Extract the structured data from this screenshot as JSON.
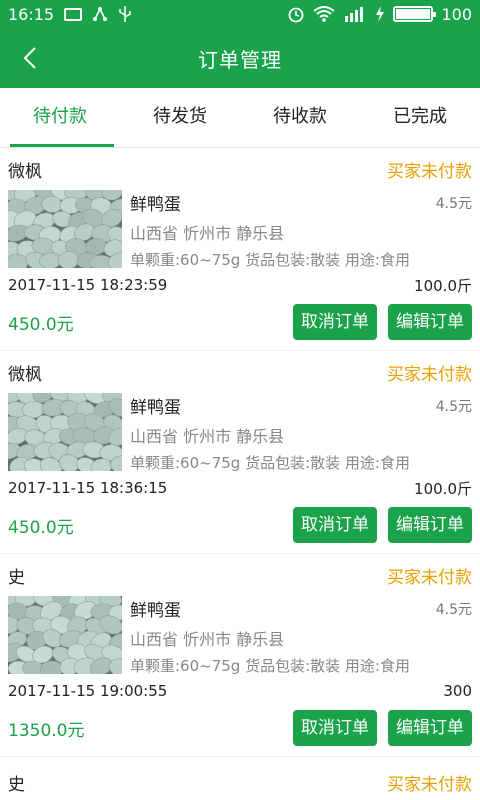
{
  "status_bar": {
    "time": "16:15",
    "battery": "100",
    "battery_level": 1.0
  },
  "header": {
    "title": "订单管理",
    "back_icon": "chevron-left-icon"
  },
  "tabs": [
    {
      "label": "待付款",
      "active": true
    },
    {
      "label": "待发货",
      "active": false
    },
    {
      "label": "待收款",
      "active": false
    },
    {
      "label": "已完成",
      "active": false
    }
  ],
  "orders": [
    {
      "buyer": "微枫",
      "status": "买家未付款",
      "product": "鲜鸭蛋",
      "unit_price": "4.5元",
      "location": "山西省 忻州市 静乐县",
      "spec": "单颗重:60~75g  货品包装:散装  用途:食用",
      "time": "2017-11-15 18:23:59",
      "quantity": "100.0斤",
      "total": "450.0元",
      "cancel_label": "取消订单",
      "edit_label": "编辑订单"
    },
    {
      "buyer": "微枫",
      "status": "买家未付款",
      "product": "鲜鸭蛋",
      "unit_price": "4.5元",
      "location": "山西省 忻州市 静乐县",
      "spec": "单颗重:60~75g  货品包装:散装  用途:食用",
      "time": "2017-11-15 18:36:15",
      "quantity": "100.0斤",
      "total": "450.0元",
      "cancel_label": "取消订单",
      "edit_label": "编辑订单"
    },
    {
      "buyer": "史",
      "status": "买家未付款",
      "product": "鲜鸭蛋",
      "unit_price": "4.5元",
      "location": "山西省 忻州市 静乐县",
      "spec": "单颗重:60~75g  货品包装:散装  用途:食用",
      "time": "2017-11-15 19:00:55",
      "quantity": "300",
      "total": "1350.0元",
      "cancel_label": "取消订单",
      "edit_label": "编辑订单"
    }
  ],
  "partial_order": {
    "buyer": "史",
    "status": "买家未付款"
  },
  "colors": {
    "primary": "#1aa34a",
    "status_warning": "#e8a000"
  }
}
